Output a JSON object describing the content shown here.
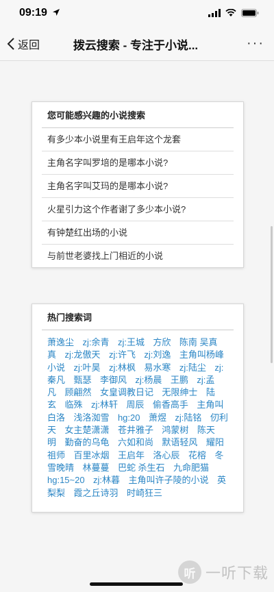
{
  "status": {
    "time": "09:19"
  },
  "nav": {
    "back_label": "返回",
    "title": "拨云搜索 - 专注于小说...",
    "more": "···"
  },
  "suggest": {
    "title": "您可能感兴趣的小说搜索",
    "items": [
      "有多少本小说里有王启年这个龙套",
      "主角名字叫罗培的是哪本小说?",
      "主角名字叫艾玛的是哪本小说?",
      "火星引力这个作者谢了多少本小说?",
      "有钟楚红出场的小说",
      "与前世老婆找上门相近的小说"
    ]
  },
  "hot": {
    "title": "热门搜索词",
    "words": [
      "萧逸尘",
      "zj:余青",
      "zj:王城",
      "方欣",
      "陈南 吴真真",
      "zj:龙傲天",
      "zj:许飞",
      "zj:刘逸",
      "主角叫杨峰小说",
      "zj:叶昊",
      "zj:林枫",
      "易水寒",
      "zj:陆尘",
      "zj:秦凡",
      "甄瑟",
      "李御风",
      "zj:杨晨",
      "王鹏",
      "zj:孟凡",
      "顾翩然",
      "女皇调教日记",
      "无限绅士",
      "陆玄",
      "临殊",
      "zj:林轩",
      "周辰",
      "偷香高手",
      "主角叫白洛",
      "浅洛洳雪",
      "hg:20",
      "萧煜",
      "zj:陆铭",
      "仞利天",
      "女主楚潇潇",
      "苍井雅子",
      "鸿蒙树",
      "陈天明",
      "勤奋的乌龟",
      "六如和尚",
      "默语轻风",
      "耀阳祖师",
      "百里冰烟",
      "王启年",
      "洛心辰",
      "花榕",
      "冬雪晚晴",
      "林蔓蔓",
      "巴蛇 杀生石",
      "九命肥猫",
      "hg:15~20",
      "zj:林暮",
      "主角叫许子陵的小说",
      "英梨梨",
      "霞之丘诗羽",
      "时崎狂三"
    ]
  },
  "watermark": {
    "glyph": "听",
    "text": "一听下载"
  },
  "colors": {
    "link": "#2b86c5",
    "background": "#f5f5f5"
  }
}
